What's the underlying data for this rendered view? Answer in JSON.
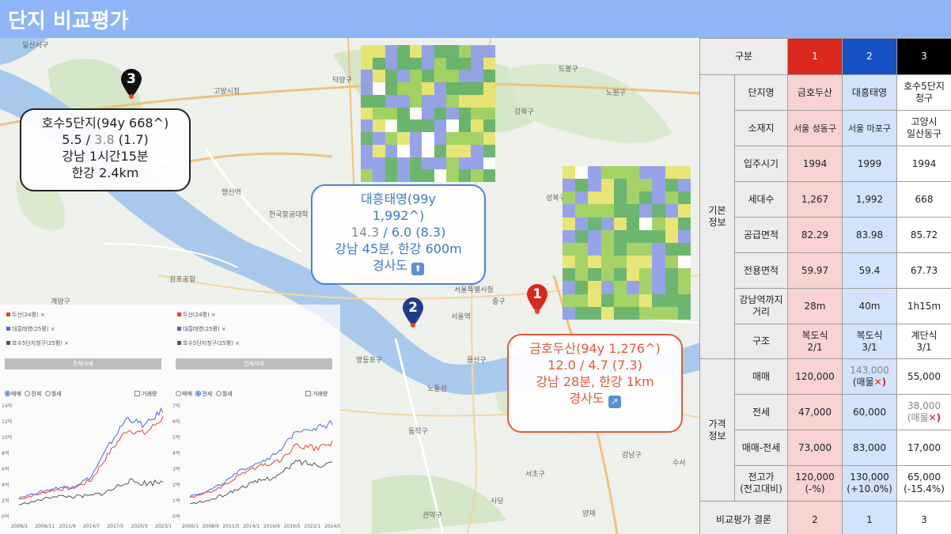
{
  "header": {
    "title": "단지 비교평가"
  },
  "map": {
    "place_labels": [
      "일산서구",
      "고양시청",
      "덕양구",
      "도봉구",
      "노원구",
      "강북구",
      "성북구",
      "행신역",
      "한국항공대학",
      "김포공항",
      "계양구",
      "서울특별시청",
      "서울역",
      "중구",
      "용산구",
      "동작구",
      "서초구",
      "강남구",
      "영등포구",
      "노들섬",
      "사당",
      "관악구",
      "수서",
      "양재"
    ]
  },
  "callouts": {
    "c3": {
      "line1": "호수5단지(94y 668^)",
      "line2_a": "5.5 / ",
      "line2_b": "3.8",
      "line2_c": " (1.7)",
      "line3": "강남 1시간15분",
      "line4": "한강 2.4km"
    },
    "c2": {
      "line1": "대흥태영(99y",
      "line2": "1,992^)",
      "line3_a": "14.3",
      "line3_b": " / 6.0 (8.3)",
      "line4": "강남 45분, 한강 600m",
      "line5": "경사도",
      "icon": "⬆"
    },
    "c1": {
      "line1": "금호두산(94y 1,276^)",
      "line2": "12.0 / 4.7 (7.3)",
      "line3": "강남 28분, 한강 1km",
      "line4": "경사도",
      "icon": "↗"
    }
  },
  "pins": {
    "p1": "1",
    "p2": "2",
    "p3": "3"
  },
  "panels": {
    "left": {
      "legend": [
        "두산(24평)",
        "대흥태영(25평)",
        "호수5단지청구(25평)"
      ],
      "reset": "전체삭제",
      "radio": [
        "매매",
        "전세",
        "월세"
      ],
      "checkbox": "거래량",
      "selected": "매매"
    },
    "right": {
      "legend": [
        "두산(24평)",
        "대흥태영(25평)",
        "호수5단지청구(25평)"
      ],
      "reset": "전체삭제",
      "radio": [
        "매매",
        "전세",
        "월세"
      ],
      "checkbox": "거래량",
      "selected": "전세"
    }
  },
  "chart_data": [
    {
      "type": "line",
      "x": [
        "2006/1",
        "2008/11",
        "2011/9",
        "2014/7",
        "2017/5",
        "2020/3",
        "2023/1"
      ],
      "ylim": [
        0,
        14
      ],
      "yticks": [
        "0억",
        "2억",
        "4억",
        "6억",
        "8억",
        "10억",
        "12억",
        "14억"
      ],
      "series": [
        {
          "name": "두산(24평)",
          "color": "#e8422e",
          "values": [
            2.2,
            2.8,
            3.4,
            3.6,
            4.6,
            8.0,
            11.0,
            10.5,
            12.5
          ]
        },
        {
          "name": "대흥태영(25평)",
          "color": "#4d64e0",
          "values": [
            2.4,
            3.0,
            3.6,
            3.8,
            5.0,
            9.0,
            12.5,
            11.5,
            13.5
          ]
        },
        {
          "name": "호수5단지청구(25평)",
          "color": "#555555",
          "values": [
            1.5,
            2.0,
            2.6,
            2.5,
            2.6,
            3.2,
            4.5,
            4.2,
            4.4
          ]
        }
      ]
    },
    {
      "type": "line",
      "x": [
        "2006/1",
        "2008/9",
        "2011/5",
        "2014/1",
        "2016/9",
        "2019/5",
        "2022/1",
        "2024/9"
      ],
      "ylim": [
        0,
        7
      ],
      "yticks": [
        "0억",
        "1억",
        "2억",
        "3억",
        "4억",
        "5억",
        "6억",
        "7억"
      ],
      "series": [
        {
          "name": "두산(24평)",
          "color": "#e8422e",
          "values": [
            1.2,
            1.5,
            2.0,
            2.8,
            3.2,
            3.5,
            4.5,
            4.3,
            4.6
          ]
        },
        {
          "name": "대흥태영(25평)",
          "color": "#4d64e0",
          "values": [
            1.3,
            1.6,
            2.2,
            3.0,
            3.5,
            4.0,
            5.5,
            5.6,
            5.9
          ]
        },
        {
          "name": "호수5단지청구(25평)",
          "color": "#555555",
          "values": [
            0.8,
            1.0,
            1.4,
            1.9,
            2.3,
            2.6,
            3.5,
            3.3,
            3.4
          ]
        }
      ]
    }
  ],
  "table": {
    "head": {
      "category": "구분",
      "c1": "1",
      "c2": "2",
      "c3": "3"
    },
    "group_basic": "기본\n정보",
    "group_price": "가격\n정보",
    "rows": {
      "name": {
        "label": "단지명",
        "v1": "금호두산",
        "v2": "대흥태영",
        "v3": "호수5단지\n청구"
      },
      "location": {
        "label": "소재지",
        "v1": "서울 성동구",
        "v2": "서울 마포구",
        "v3": "고양시\n일산동구"
      },
      "year": {
        "label": "입주시기",
        "v1": "1994",
        "v2": "1999",
        "v3": "1994"
      },
      "households": {
        "label": "세대수",
        "v1": "1,267",
        "v2": "1,992",
        "v3": "668"
      },
      "supply": {
        "label": "공급면적",
        "v1": "82.29",
        "v2": "83.98",
        "v3": "85.72"
      },
      "exclusive": {
        "label": "전용면적",
        "v1": "59.97",
        "v2": "59.4",
        "v3": "67.73"
      },
      "distance": {
        "label": "강남역까지\n거리",
        "v1": "28m",
        "v2": "40m",
        "v3": "1h15m"
      },
      "structure": {
        "label": "구조",
        "v1": "복도식\n2/1",
        "v2": "복도식\n3/1",
        "v3": "계단식\n3/1"
      },
      "sale": {
        "label": "매매",
        "v1": "120,000",
        "v2": "143,000",
        "v2b": "(매물",
        "v3": "55,000"
      },
      "jeonse": {
        "label": "전세",
        "v1": "47,000",
        "v2": "60,000",
        "v3": "38,000",
        "v3b": "(매물"
      },
      "gap": {
        "label": "매매-전세",
        "v1": "73,000",
        "v2": "83,000",
        "v3": "17,000"
      },
      "peak": {
        "label": "전고가\n(전고대비)",
        "v1": "120,000\n(-%)",
        "v2": "130,000\n(+10.0%)",
        "v3": "65,000\n(-15.4%)"
      }
    },
    "conclusion": {
      "label": "비교평가 결론",
      "v1": "2",
      "v2": "1",
      "v3": "3"
    },
    "xmark": "✕)"
  }
}
